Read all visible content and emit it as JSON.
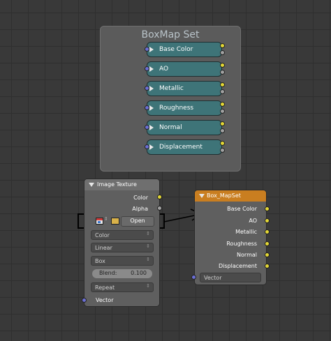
{
  "frame": {
    "title": "BoxMap Set"
  },
  "group_nodes": [
    {
      "label": "Base Color"
    },
    {
      "label": "AO"
    },
    {
      "label": "Metallic"
    },
    {
      "label": "Roughness"
    },
    {
      "label": "Normal"
    },
    {
      "label": "Displacement"
    }
  ],
  "image_texture": {
    "title": "Image Texture",
    "outputs": {
      "color": "Color",
      "alpha": "Alpha"
    },
    "open_label": "Open",
    "color_mode": "Color",
    "interpolation": "Linear",
    "projection": "Box",
    "blend_label": "Blend:",
    "blend_value": "0.100",
    "extension": "Repeat",
    "input_vector": "Vector"
  },
  "box_mapset": {
    "title": "Box_MapSet",
    "inputs": [
      "Base Color",
      "AO",
      "Metallic",
      "Roughness",
      "Normal",
      "Displacement"
    ],
    "vector_dropdown": "Vector"
  },
  "colors": {
    "frame_bg": "#5b5b5b",
    "teal_node": "#3e7478",
    "group_header_orange": "#c97e20",
    "socket_yellow": "#e3d735",
    "socket_blue": "#6b6fd4",
    "socket_grey": "#a1a1a1",
    "annotation_black": "#000000"
  },
  "icons": [
    "expand-arrow-icon",
    "image-icon",
    "folder-icon",
    "collapse-triangle-icon",
    "dropdown-chevron-icon"
  ]
}
